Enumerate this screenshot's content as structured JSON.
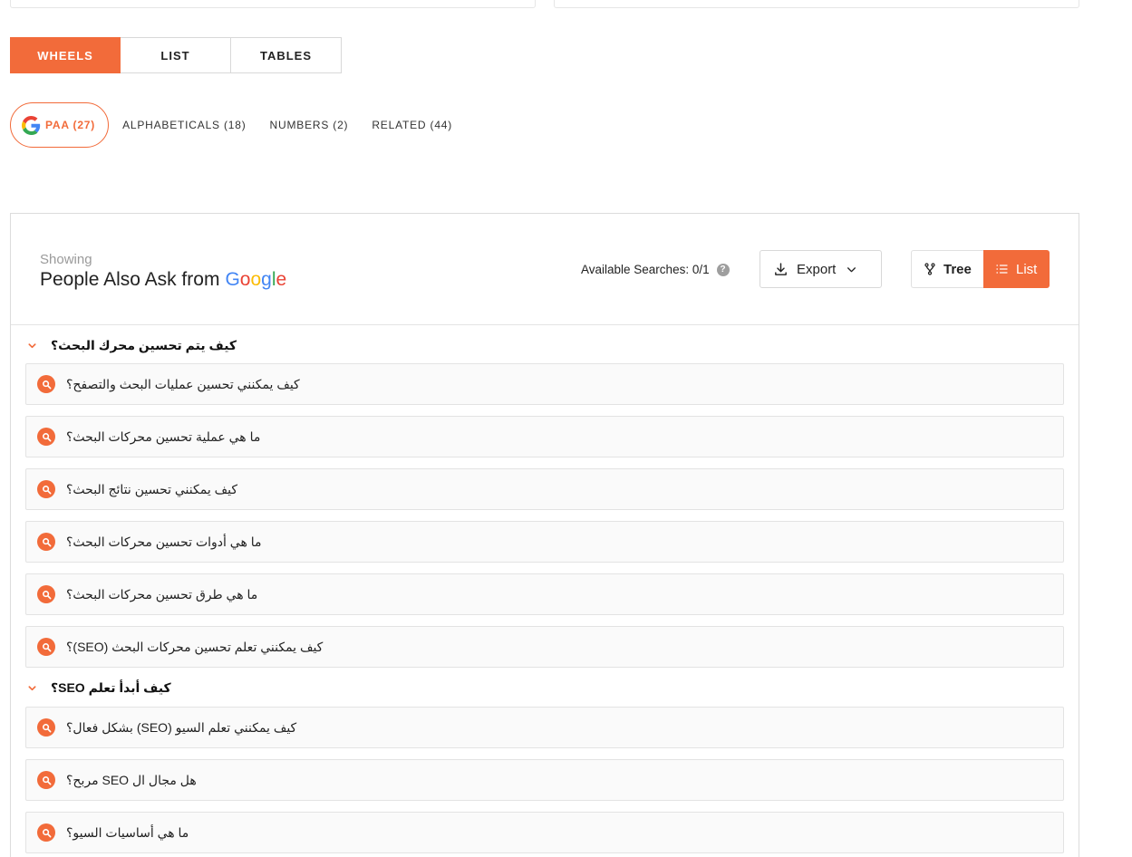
{
  "view_tabs": [
    {
      "label": "WHEELS",
      "active": true
    },
    {
      "label": "LIST",
      "active": false
    },
    {
      "label": "TABLES",
      "active": false
    }
  ],
  "sub_tabs": [
    {
      "label": "PAA (27)",
      "active": true,
      "icon": "google-g-icon"
    },
    {
      "label": "ALPHABETICALS (18)",
      "active": false
    },
    {
      "label": "NUMBERS (2)",
      "active": false
    },
    {
      "label": "RELATED (44)",
      "active": false
    }
  ],
  "panel": {
    "showing": "Showing",
    "title": "People Also Ask from",
    "brand": "Google",
    "available_label": "Available Searches: 0/1",
    "export_label": "Export",
    "toggle": {
      "tree": "Tree",
      "list": "List",
      "active": "list"
    }
  },
  "groups": [
    {
      "heading": "كيف يتم تحسين محرك البحث؟",
      "items": [
        "كيف يمكنني تحسين عمليات البحث والتصفح؟",
        "ما هي عملية تحسين محركات البحث؟",
        "كيف يمكنني تحسين نتائج البحث؟",
        "ما هي أدوات تحسين محركات البحث؟",
        "ما هي طرق تحسين محركات البحث؟",
        "كيف يمكنني تعلم تحسين محركات البحث (SEO)؟"
      ]
    },
    {
      "heading": "كيف أبدأ تعلم SEO؟",
      "items": [
        "كيف يمكنني تعلم السيو (SEO) بشكل فعال؟",
        "هل مجال ال SEO مربح؟",
        "ما هي أساسيات السيو؟"
      ]
    }
  ],
  "colors": {
    "accent": "#f26b3a"
  }
}
